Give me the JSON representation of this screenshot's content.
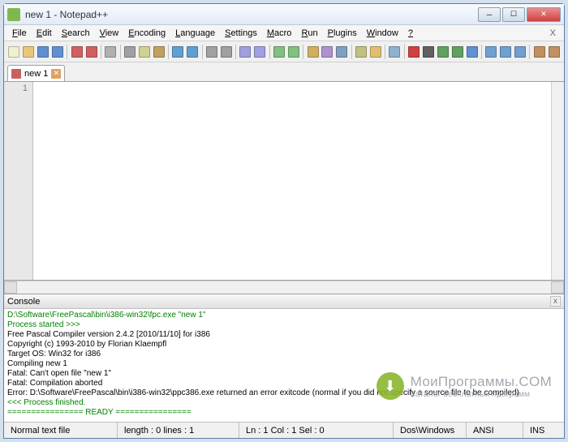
{
  "title": "new  1 - Notepad++",
  "menu": [
    "File",
    "Edit",
    "Search",
    "View",
    "Encoding",
    "Language",
    "Settings",
    "Macro",
    "Run",
    "Plugins",
    "Window",
    "?"
  ],
  "tab": {
    "label": "new  1"
  },
  "gutter": {
    "line1": "1"
  },
  "console": {
    "title": "Console",
    "lines": [
      {
        "cls": "gr",
        "t": "D:\\Software\\FreePascal\\bin\\i386-win32\\fpc.exe \"new  1\""
      },
      {
        "cls": "gr",
        "t": "Process started >>>"
      },
      {
        "cls": "bk",
        "t": "Free Pascal Compiler version 2.4.2 [2010/11/10] for i386"
      },
      {
        "cls": "bk",
        "t": "Copyright (c) 1993-2010 by Florian Klaempfl"
      },
      {
        "cls": "bk",
        "t": "Target OS: Win32 for i386"
      },
      {
        "cls": "bk",
        "t": "Compiling new  1"
      },
      {
        "cls": "bk",
        "t": "Fatal: Can't open file \"new  1\""
      },
      {
        "cls": "bk",
        "t": "Fatal: Compilation aborted"
      },
      {
        "cls": "bk",
        "t": "Error: D:\\Software\\FreePascal\\bin\\i386-win32\\ppc386.exe returned an error exitcode (normal if you did not specify a source file to be compiled)"
      },
      {
        "cls": "gr",
        "t": "<<< Process finished."
      },
      {
        "cls": "gr",
        "t": "================ READY ================"
      }
    ]
  },
  "status": {
    "filetype": "Normal text file",
    "length": "length : 0    lines : 1",
    "pos": "Ln : 1    Col : 1    Sel : 0",
    "eol": "Dos\\Windows",
    "enc": "ANSI",
    "ins": "INS"
  },
  "watermark": {
    "big": "МоиПрограммы.COM",
    "small": "Каталог бесплатных программ"
  },
  "toolbar_icons": [
    "new-file",
    "open-file",
    "save",
    "save-all",
    "sep",
    "close",
    "close-all",
    "sep",
    "print",
    "sep",
    "cut",
    "copy",
    "paste",
    "sep",
    "undo",
    "redo",
    "sep",
    "find",
    "replace",
    "sep",
    "zoom-in",
    "zoom-out",
    "sep",
    "sync-v",
    "sync-h",
    "sep",
    "wrap",
    "show-all",
    "indent-guide",
    "sep",
    "lang",
    "folder",
    "sep",
    "func-list",
    "sep",
    "record",
    "stop",
    "play",
    "play-multi",
    "save-macro",
    "sep",
    "toggle-1",
    "toggle-2",
    "toggle-3",
    "sep",
    "panel-1",
    "panel-2"
  ],
  "icon_colors": {
    "new-file": "#f0f0d0",
    "open-file": "#e8c878",
    "save": "#6090d0",
    "save-all": "#6090d0",
    "close": "#d06060",
    "close-all": "#d06060",
    "print": "#b0b0b0",
    "cut": "#a0a0a0",
    "copy": "#d0d090",
    "paste": "#c0a060",
    "undo": "#60a0d0",
    "redo": "#60a0d0",
    "find": "#a0a0a0",
    "replace": "#a0a0a0",
    "zoom-in": "#a0a0e0",
    "zoom-out": "#a0a0e0",
    "sync-v": "#80c080",
    "sync-h": "#80c080",
    "wrap": "#d0b060",
    "show-all": "#b090d0",
    "indent-guide": "#80a0c0",
    "lang": "#c0c080",
    "folder": "#e0c070",
    "func-list": "#90b0d0",
    "record": "#d04040",
    "stop": "#606060",
    "play": "#60a060",
    "play-multi": "#60a060",
    "save-macro": "#6090d0",
    "toggle-1": "#70a0d0",
    "toggle-2": "#70a0d0",
    "toggle-3": "#70a0d0",
    "panel-1": "#c09060",
    "panel-2": "#c09060"
  }
}
